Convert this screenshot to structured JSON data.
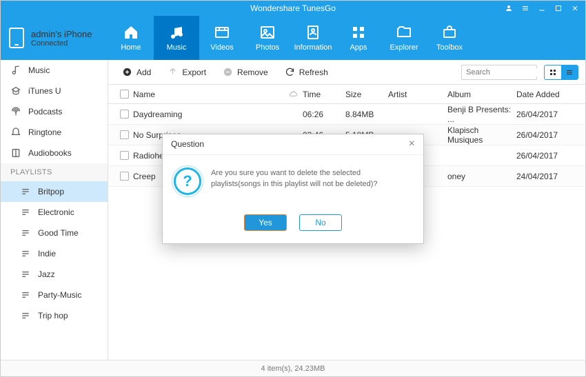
{
  "title": "Wondershare TunesGo",
  "device": {
    "name": "admin's iPhone",
    "status": "Connected"
  },
  "nav": [
    {
      "label": "Home"
    },
    {
      "label": "Music"
    },
    {
      "label": "Videos"
    },
    {
      "label": "Photos"
    },
    {
      "label": "Information"
    },
    {
      "label": "Apps"
    },
    {
      "label": "Explorer"
    },
    {
      "label": "Toolbox"
    }
  ],
  "sidebar": {
    "library": [
      {
        "label": "Music"
      },
      {
        "label": "iTunes U"
      },
      {
        "label": "Podcasts"
      },
      {
        "label": "Ringtone"
      },
      {
        "label": "Audiobooks"
      }
    ],
    "playlists_header": "PLAYLISTS",
    "playlists": [
      {
        "label": "Britpop"
      },
      {
        "label": "Electronic"
      },
      {
        "label": "Good Time"
      },
      {
        "label": "Indie"
      },
      {
        "label": "Jazz"
      },
      {
        "label": "Party-Music"
      },
      {
        "label": "Trip hop"
      }
    ]
  },
  "toolbar": {
    "add": "Add",
    "export": "Export",
    "remove": "Remove",
    "refresh": "Refresh"
  },
  "search": {
    "placeholder": "Search"
  },
  "columns": {
    "name": "Name",
    "time": "Time",
    "size": "Size",
    "artist": "Artist",
    "album": "Album",
    "date": "Date Added"
  },
  "rows": [
    {
      "name": "Daydreaming",
      "time": "06:26",
      "size": "8.84MB",
      "artist": "",
      "album": "Benji B Presents: ...",
      "date": "26/04/2017"
    },
    {
      "name": "No Surprises",
      "time": "03:46",
      "size": "5.18MB",
      "artist": "",
      "album": "Klapisch Musiques",
      "date": "26/04/2017"
    },
    {
      "name": "Radiohead",
      "time": "",
      "size": "",
      "artist": "",
      "album": "",
      "date": "26/04/2017"
    },
    {
      "name": "Creep",
      "time": "",
      "size": "",
      "artist": "",
      "album": "oney",
      "date": "24/04/2017"
    }
  ],
  "status": "4 item(s), 24.23MB",
  "dialog": {
    "title": "Question",
    "message": "Are you sure you want to delete the selected playlists(songs in this playlist will not be deleted)?",
    "yes": "Yes",
    "no": "No"
  }
}
